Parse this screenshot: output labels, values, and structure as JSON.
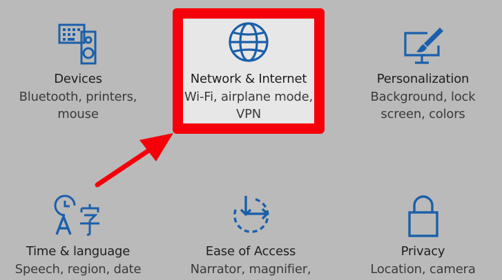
{
  "tiles": {
    "devices": {
      "title": "Devices",
      "desc_line1": "Bluetooth, printers,",
      "desc_line2": "mouse",
      "icon": "devices-icon"
    },
    "network": {
      "title": "Network & Internet",
      "desc_line1": "Wi-Fi, airplane mode,",
      "desc_line2": "VPN",
      "icon": "globe-icon"
    },
    "personalization": {
      "title": "Personalization",
      "desc_line1": "Background, lock",
      "desc_line2": "screen, colors",
      "icon": "paintbrush-monitor-icon"
    },
    "time": {
      "title": "Time & language",
      "desc_line1": "Speech, region, date",
      "icon": "time-language-icon"
    },
    "ease": {
      "title": "Ease of Access",
      "desc_line1": "Narrator, magnifier,",
      "icon": "ease-of-access-icon"
    },
    "privacy": {
      "title": "Privacy",
      "desc_line1": "Location, camera",
      "icon": "lock-icon"
    }
  },
  "colors": {
    "background": "#bababa",
    "icon_blue": "#1a5faa",
    "highlight_red": "#f5000a",
    "highlight_fill": "#e7e7e7"
  },
  "annotation": {
    "type": "red-arrow",
    "target": "network"
  }
}
